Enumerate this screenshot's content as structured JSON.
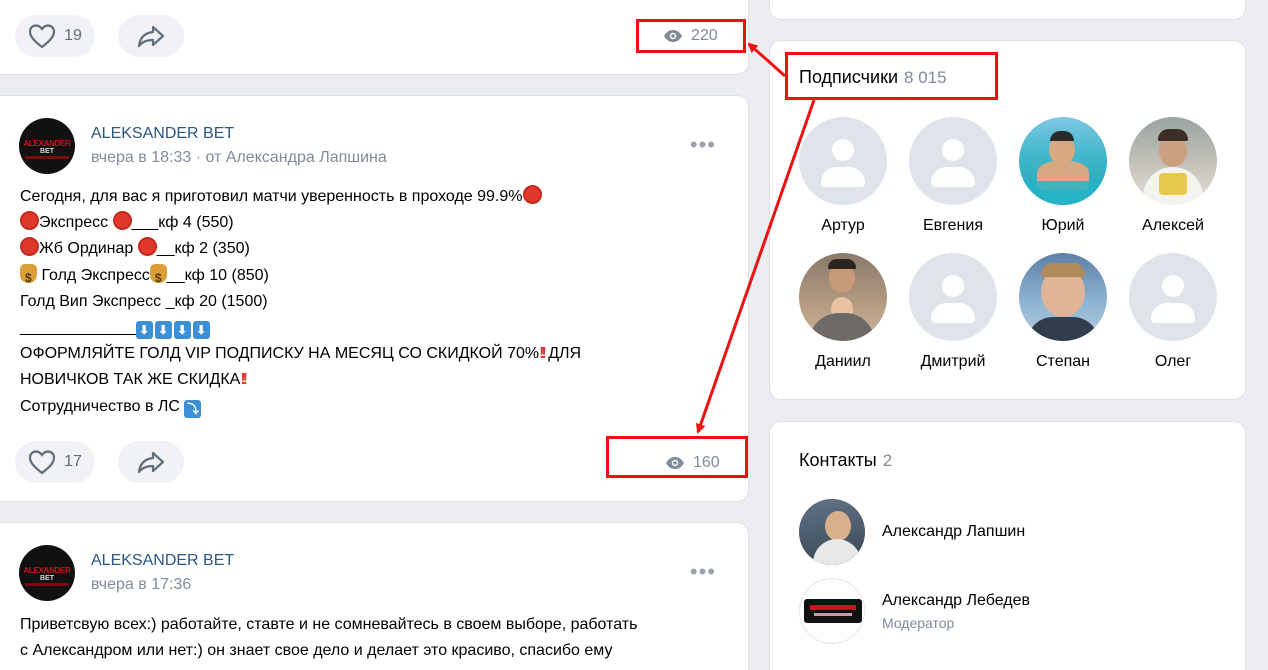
{
  "posts": [
    {
      "likes": "19",
      "views": "220"
    },
    {
      "author": "ALEKSANDER BET",
      "time": "вчера в 18:33",
      "from_sep": " · ",
      "from": "от Александра Лапшина",
      "lines": [
        "Сегодня, для вас я приготовил матчи уверенность в проходе 99.9%",
        "Экспресс ",
        "___кф 4 (550)",
        "Жб Ординар ",
        "__кф 2 (350)",
        " Голд Экспресс",
        "__кф 10 (850)",
        "Голд Вип Экспресс _кф 20 (1500)",
        "_____________",
        "ОФОРМЛЯЙТЕ ГОЛД VIP ПОДПИСКУ НА МЕСЯЦ СО СКИДКОЙ 70%",
        " ДЛЯ",
        "НОВИЧКОВ ТАК ЖЕ СКИДКА",
        "Сотрудничество в ЛС "
      ],
      "likes": "17",
      "views": "160"
    },
    {
      "author": "ALEKSANDER BET",
      "time": "вчера в 17:36",
      "lines": [
        "Приветсвую всех:) работайте, ставте и не сомневайтесь в своем выборе, работать",
        "с Александром или нет:) он знает свое дело и делает это красиво, спасибо ему"
      ]
    }
  ],
  "avatar_logo": {
    "line1": "ALEXANDER",
    "line2": "BET"
  },
  "subscribers": {
    "title": "Подписчики",
    "count": "8 015",
    "members": [
      {
        "name": "Артур",
        "photo": false
      },
      {
        "name": "Евгения",
        "photo": false
      },
      {
        "name": "Юрий",
        "photo": true
      },
      {
        "name": "Алексей",
        "photo": true
      },
      {
        "name": "Даниил",
        "photo": true
      },
      {
        "name": "Дмитрий",
        "photo": false
      },
      {
        "name": "Степан",
        "photo": true
      },
      {
        "name": "Олег",
        "photo": false
      }
    ]
  },
  "contacts": {
    "title": "Контакты",
    "count": "2",
    "items": [
      {
        "name": "Александр Лапшин",
        "role": ""
      },
      {
        "name": "Александр Лебедев",
        "role": "Модератор"
      }
    ]
  },
  "colors": {
    "link": "#2a5885",
    "muted": "#818c99",
    "annotation": "#ee1111",
    "page_bg": "#ebedf0"
  },
  "icons": [
    "heart-icon",
    "share-icon",
    "eye-icon",
    "more-dots-icon",
    "stop-sign-emoji",
    "money-bag-emoji",
    "down-arrow-emoji",
    "double-exclamation-emoji",
    "right-down-arrow-emoji"
  ]
}
